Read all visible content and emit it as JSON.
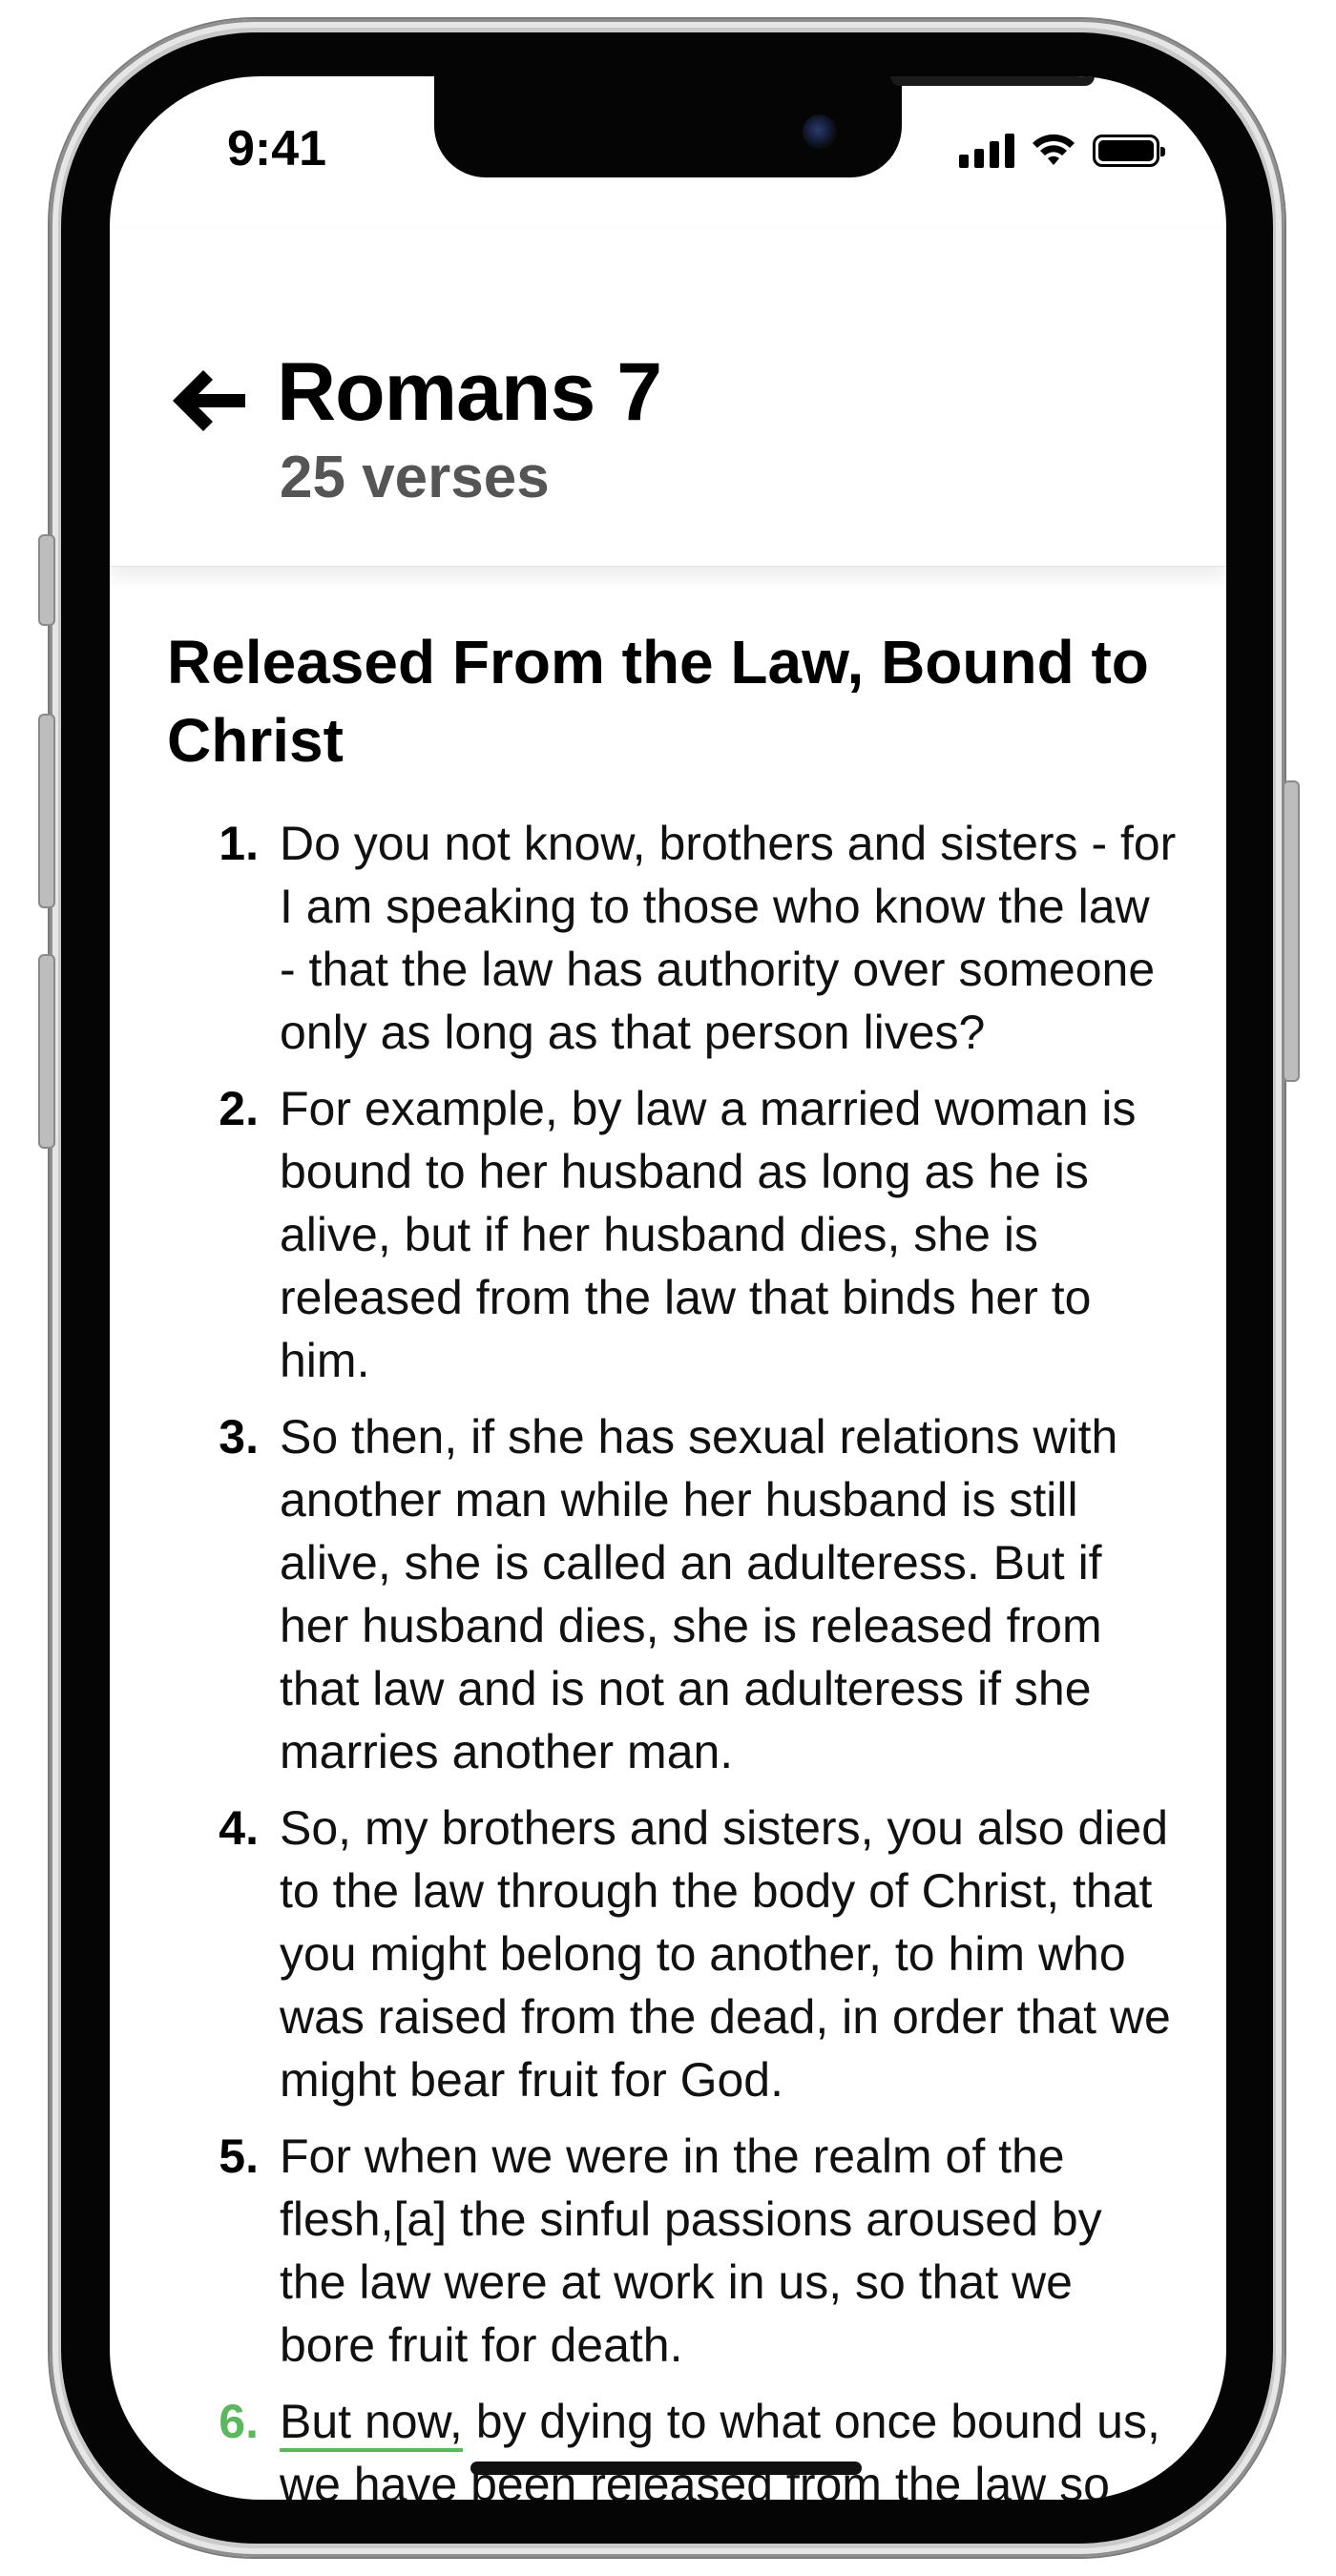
{
  "status_bar": {
    "time": "9:41"
  },
  "header": {
    "back_label": "back",
    "title": "Romans 7",
    "subtitle": "25 verses"
  },
  "section": {
    "heading": "Released From the Law, Bound to Christ"
  },
  "verses": [
    {
      "number": "1.",
      "text": "Do you not know, brothers and sisters - for I am speaking to those who know the law - that the law has authority over someone only as long as that person lives?"
    },
    {
      "number": "2.",
      "text": "For example, by law a married woman is bound to her husband as long as he is alive, but if her husband dies, she is released from the law that binds her to him."
    },
    {
      "number": "3.",
      "text": "So then, if she has sexual relations with another man while her husband is still alive, she is called an adulteress. But if her husband dies, she is released from that law and is not an adulteress if she marries another man."
    },
    {
      "number": "4.",
      "text": "So, my brothers and sisters, you also died to the law through the body of Christ, that you might belong to another, to him who was raised from the dead, in order that we might bear fruit for God."
    },
    {
      "number": "5.",
      "text": "For when we were in the realm of the flesh,[a] the sinful passions aroused by the law were at work in us, so that we bore fruit for death."
    },
    {
      "number": "6.",
      "highlight": "But now,",
      "text": " by dying to what once bound us, we have been released from the law so"
    }
  ],
  "colors": {
    "accent": "#5cb85c",
    "subtitle": "#555555"
  },
  "icons": {
    "back": "arrow-left-icon"
  }
}
